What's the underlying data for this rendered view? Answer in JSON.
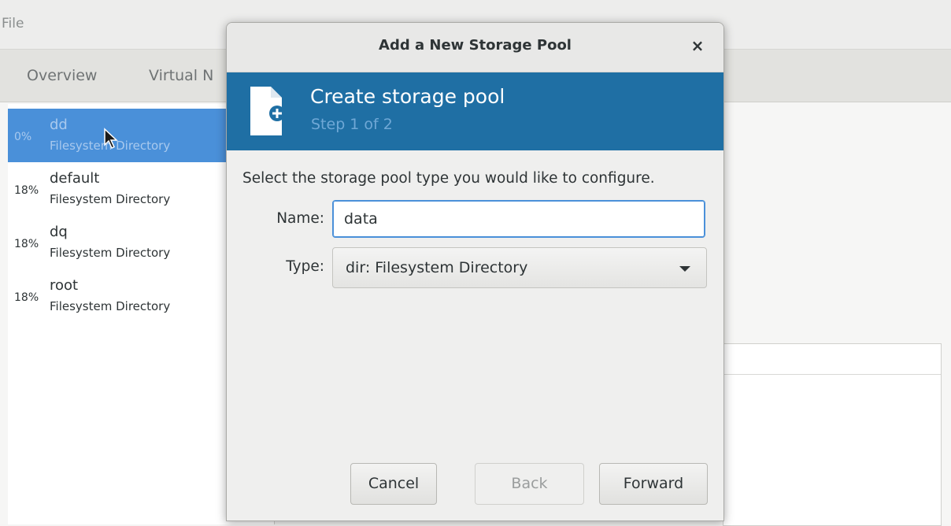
{
  "menu": {
    "file_label": "File"
  },
  "tabs": [
    {
      "label": "Overview"
    },
    {
      "label": "Virtual N"
    }
  ],
  "pools": [
    {
      "usage": "0%",
      "name": "dd",
      "type": "Filesystem Directory",
      "selected": true
    },
    {
      "usage": "18%",
      "name": "default",
      "type": "Filesystem Directory",
      "selected": false
    },
    {
      "usage": "18%",
      "name": "dq",
      "type": "Filesystem Directory",
      "selected": false
    },
    {
      "usage": "18%",
      "name": "root",
      "type": "Filesystem Directory",
      "selected": false
    }
  ],
  "dialog": {
    "title": "Add a New Storage Pool",
    "close_icon": "×",
    "banner": {
      "title": "Create storage pool",
      "step": "Step 1 of 2",
      "icon": "new-document-icon",
      "color": "#1f6fa4"
    },
    "instructions": "Select the storage pool type you would like to configure.",
    "name_label": "Name:",
    "name_value": "data",
    "type_label": "Type:",
    "type_value": "dir: Filesystem Directory",
    "buttons": {
      "cancel": "Cancel",
      "back": "Back",
      "forward": "Forward"
    }
  },
  "colors": {
    "selection": "#4a90d9",
    "banner": "#1f6fa4"
  }
}
